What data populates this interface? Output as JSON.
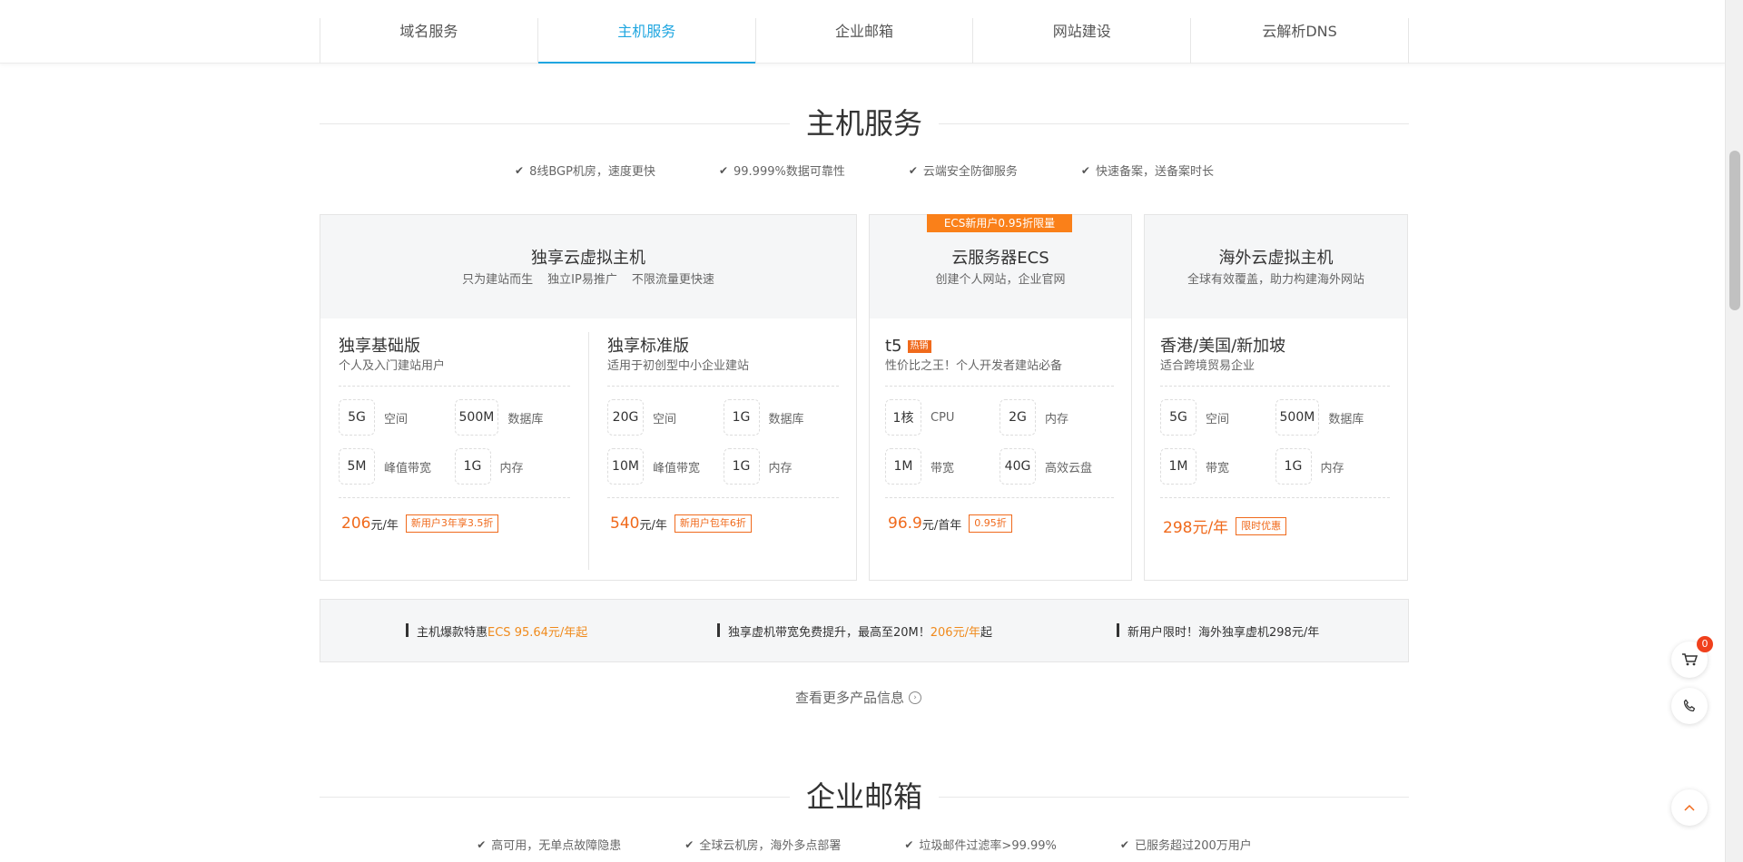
{
  "nav": {
    "tabs": [
      {
        "label": "域名服务"
      },
      {
        "label": "主机服务"
      },
      {
        "label": "企业邮箱"
      },
      {
        "label": "网站建设"
      },
      {
        "label": "云解析DNS"
      }
    ],
    "active": 1
  },
  "host_section": {
    "title": "主机服务",
    "features": [
      "8线BGP机房，速度更快",
      "99.999%数据可靠性",
      "云端安全防御服务",
      "快速备案，送备案时长"
    ]
  },
  "cards": {
    "exclusive": {
      "name": "独享云虚拟主机",
      "desc": [
        "只为建站而生",
        "独立IP易推广",
        "不限流量更快速"
      ],
      "plans": [
        {
          "name": "独享基础版",
          "desc": "个人及入门建站用户",
          "specs": [
            {
              "v": "5G",
              "l": "空间"
            },
            {
              "v": "500M",
              "l": "数据库"
            },
            {
              "v": "5M",
              "l": "峰值带宽"
            },
            {
              "v": "1G",
              "l": "内存"
            }
          ],
          "price": "206",
          "unit": "元/年",
          "tag": "新用户3年享3.5折"
        },
        {
          "name": "独享标准版",
          "desc": "适用于初创型中小企业建站",
          "specs": [
            {
              "v": "20G",
              "l": "空间"
            },
            {
              "v": "1G",
              "l": "数据库"
            },
            {
              "v": "10M",
              "l": "峰值带宽"
            },
            {
              "v": "1G",
              "l": "内存"
            }
          ],
          "price": "540",
          "unit": "元/年",
          "tag": "新用户包年6折"
        }
      ]
    },
    "ecs": {
      "ribbon": "ECS新用户0.95折限量",
      "name": "云服务器ECS",
      "desc": "创建个人网站，企业官网",
      "plan": {
        "name": "t5",
        "hot": "热销",
        "desc": "性价比之王！个人开发者建站必备",
        "specs": [
          {
            "v": "1核",
            "l": "CPU"
          },
          {
            "v": "2G",
            "l": "内存"
          },
          {
            "v": "1M",
            "l": "带宽"
          },
          {
            "v": "40G",
            "l": "高效云盘"
          }
        ],
        "price": "96.9",
        "unit": "元/首年",
        "tag": "0.95折"
      }
    },
    "overseas": {
      "name": "海外云虚拟主机",
      "desc": "全球有效覆盖，助力构建海外网站",
      "plan": {
        "name": "香港/美国/新加坡",
        "desc": "适合跨境贸易企业",
        "specs": [
          {
            "v": "5G",
            "l": "空间"
          },
          {
            "v": "500M",
            "l": "数据库"
          },
          {
            "v": "1M",
            "l": "带宽"
          },
          {
            "v": "1G",
            "l": "内存"
          }
        ],
        "price": "298元/年",
        "unit": "",
        "tag": "限时优惠"
      }
    }
  },
  "promo": {
    "p1_a": "主机爆款特惠",
    "p1_b": "ECS 95.64元/年起",
    "p2_a": "独享虚机带宽免费提升，最高至20M！",
    "p2_b": "206元/年",
    "p2_c": "起",
    "p3_a": "新用户限时！海外独享虚机298元/年"
  },
  "more_link": "查看更多产品信息",
  "mail_section": {
    "title": "企业邮箱",
    "features": [
      "高可用，无单点故障隐患",
      "全球云机房，海外多点部署",
      "垃圾邮件过滤率>99.99%",
      "已服务超过200万用户"
    ]
  },
  "cart": {
    "count": "0"
  },
  "colors": {
    "accent": "#1fa6e0",
    "price": "#f06a1c",
    "ribbon": "#fa8019"
  }
}
